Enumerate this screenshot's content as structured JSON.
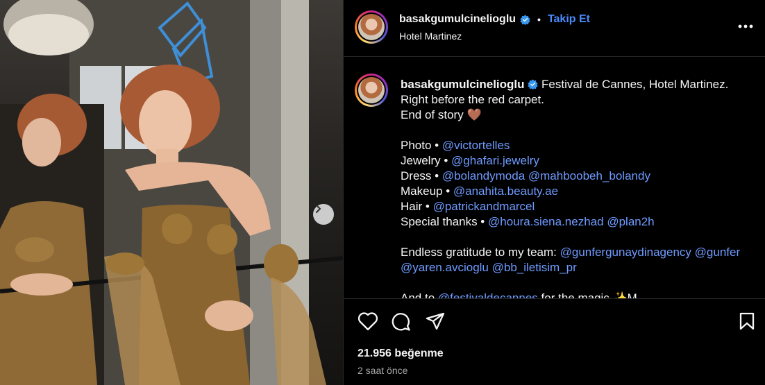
{
  "post": {
    "username": "basakgumulcinelioglu",
    "follow_label": "Takip Et",
    "location": "Hotel Martinez",
    "caption_lines": [
      "Festival de Cannes, Hotel Martinez.",
      "Right before the red carpet.",
      "End of story"
    ],
    "heart_emoji": "🤎",
    "credits": {
      "photo_label": "Photo •",
      "photo_mention": "@victortelles",
      "jewelry_label": "Jewelry •",
      "jewelry_mention": "@ghafari.jewelry",
      "dress_label": "Dress •",
      "dress_mention_1": "@bolandymoda",
      "dress_mention_2": "@mahboobeh_bolandy",
      "makeup_label": "Makeup •",
      "makeup_mention": "@anahita.beauty.ae",
      "hair_label": "Hair •",
      "hair_mention": "@patrickandmarcel",
      "thanks_label": "Special thanks •",
      "thanks_mention_1": "@houra.siena.nezhad",
      "thanks_mention_2": "@plan2h"
    },
    "gratitude": {
      "text": "Endless gratitude to my team:",
      "mention_1": "@gunfergunaydinagency",
      "mention_2": "@gunfer",
      "mention_3": "@yaren.avcioglu",
      "mention_4": "@bb_iletisim_pr"
    },
    "last_line": {
      "prefix": "And to",
      "mention": "@festivaldecannes",
      "suffix": "for the magic ✨M"
    },
    "likes": "21.956 beğenme",
    "time_ago": "2 saat önce"
  },
  "colors": {
    "link": "#6f9bff",
    "follow": "#4a8cff",
    "verified": "#3897f0",
    "divider": "#262626"
  },
  "icons": {
    "verified": "verified-badge-icon",
    "more": "more-options-icon",
    "like": "heart-icon",
    "comment": "comment-icon",
    "share": "send-icon",
    "save": "bookmark-icon",
    "next": "chevron-right-icon"
  }
}
